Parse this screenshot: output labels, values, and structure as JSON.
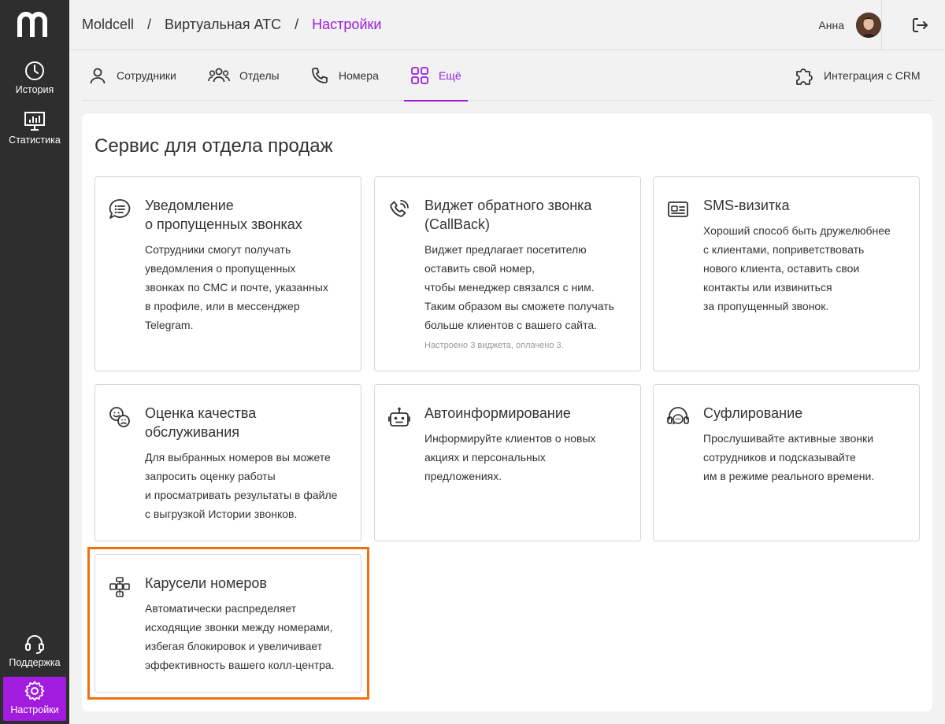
{
  "brand": {
    "logo_letter": "m",
    "accent": "#9b1ddc",
    "sidebar_bg": "#2e2e2e"
  },
  "sidebar": {
    "items": [
      {
        "label": "История",
        "icon": "clock-icon"
      },
      {
        "label": "Статистика",
        "icon": "chart-monitor-icon"
      }
    ],
    "bottom": [
      {
        "label": "Поддержка",
        "icon": "headset-icon"
      },
      {
        "label": "Настройки",
        "icon": "gear-icon",
        "active": true
      }
    ]
  },
  "header": {
    "breadcrumb": [
      "Moldcell",
      "Виртуальная АТС",
      "Настройки"
    ],
    "separator": "/",
    "user_name": "Анна"
  },
  "tabs": [
    {
      "label": "Сотрудники",
      "icon": "user-icon"
    },
    {
      "label": "Отделы",
      "icon": "users-icon"
    },
    {
      "label": "Номера",
      "icon": "phone-icon"
    },
    {
      "label": "Ещё",
      "icon": "grid-icon",
      "active": true
    },
    {
      "label": "Интеграция с CRM",
      "icon": "puzzle-icon"
    }
  ],
  "main": {
    "title": "Сервис для отдела продаж",
    "cards": [
      {
        "title": "Уведомление\nо пропущенных звонках",
        "description": "Сотрудники смогут получать\nуведомления о пропущенных\nзвонках по СМС и почте, указанных\nв профиле, или в мессенджер\nTelegram.",
        "icon": "chat-list-icon"
      },
      {
        "title": "Виджет обратного звонка\n(CallBack)",
        "description": "Виджет предлагает посетителю\nоставить свой номер,\nчтобы менеджер связался с ним.\nТаким образом вы сможете получать\nбольше клиентов с вашего сайта.",
        "note": "Настроено 3 виджета, оплачено 3.",
        "icon": "callback-phone-icon"
      },
      {
        "title": "SMS-визитка",
        "description": "Хороший способ быть дружелюбнее\nс клиентами, поприветствовать\nнового клиента, оставить свои\nконтакты или извиниться\nза пропущенный звонок.",
        "icon": "id-card-icon"
      },
      {
        "title": "Оценка качества\nобслуживания",
        "description": "Для выбранных номеров вы можете\nзапросить оценку работы\nи просматривать результаты в файле\nс выгрузкой Истории звонков.",
        "icon": "smile-sad-icon"
      },
      {
        "title": "Автоинформирование",
        "description": "Информируйте клиентов о новых\nакциях и персональных\nпредложениях.",
        "icon": "robot-icon"
      },
      {
        "title": "Суфлирование",
        "description": "Прослушивайте активные звонки\nсотрудников и подсказывайте\nим в режиме реального времени.",
        "icon": "headset-chat-icon"
      },
      {
        "title": "Карусели номеров",
        "description": "Автоматически распределяет\nисходящие звонки между номерами,\nизбегая блокировок и увеличивает\nэффективность вашего колл-центра.",
        "icon": "carousel-numbers-icon"
      }
    ]
  }
}
